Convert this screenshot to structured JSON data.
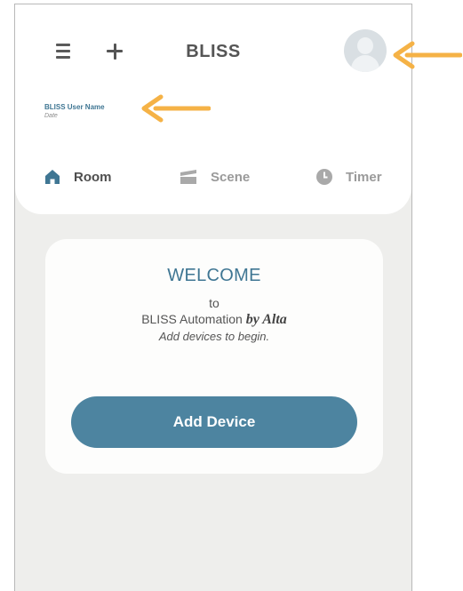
{
  "app": {
    "title": "BLISS"
  },
  "header": {
    "menu_icon": "hamburger-menu-icon",
    "add_icon": "plus-icon",
    "avatar_icon": "user-avatar-icon"
  },
  "user": {
    "name": "BLISS User Name",
    "date": "Date"
  },
  "tabs": [
    {
      "label": "Room",
      "icon": "home-icon",
      "active": true
    },
    {
      "label": "Scene",
      "icon": "scene-icon",
      "active": false
    },
    {
      "label": "Timer",
      "icon": "clock-icon",
      "active": false
    }
  ],
  "welcome_card": {
    "heading": "WELCOME",
    "to": "to",
    "brand": "BLISS Automation",
    "by": "by Alta",
    "hint": "Add devices to begin.",
    "button_label": "Add Device"
  },
  "colors": {
    "accent": "#4d84a0",
    "heading": "#3f7693",
    "background": "#eeeeec",
    "annotation_arrow": "#f5b246"
  }
}
